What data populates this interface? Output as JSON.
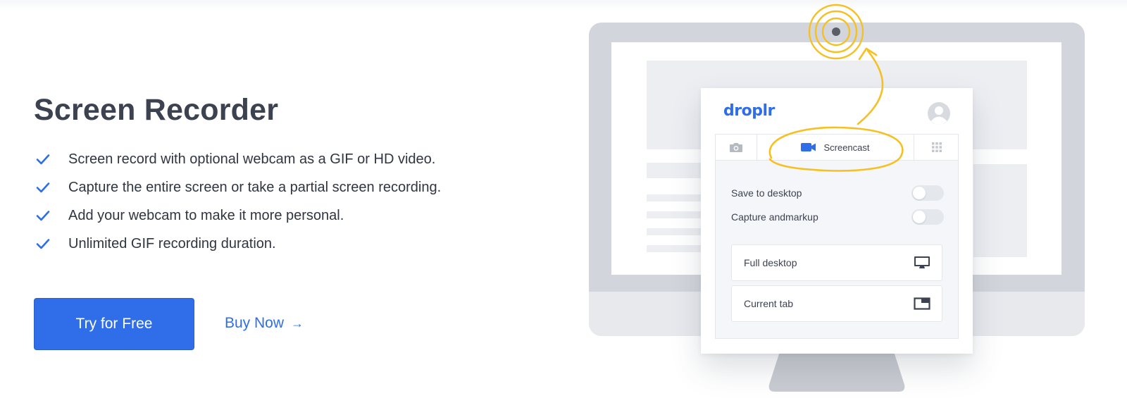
{
  "hero": {
    "title": "Screen Recorder",
    "features": [
      "Screen record with optional webcam as a GIF or HD video.",
      "Capture the entire screen or take a partial screen recording.",
      "Add your webcam to make it more personal.",
      "Unlimited GIF recording duration."
    ],
    "cta_primary": "Try for Free",
    "cta_secondary": "Buy Now",
    "secondary_arrow": "→"
  },
  "illustration": {
    "app_logo": "droplr",
    "tabs": {
      "screencast_label": "Screencast"
    },
    "options": [
      {
        "label": "Save to desktop",
        "enabled": false
      },
      {
        "label": "Capture andmarkup",
        "enabled": false
      }
    ],
    "capture_modes": [
      {
        "label": "Full desktop",
        "icon": "monitor-icon"
      },
      {
        "label": "Current tab",
        "icon": "window-tab-icon"
      }
    ]
  },
  "colors": {
    "accent": "#2f6ee8",
    "heading": "#3c4250",
    "highlight": "#f6c022",
    "monitor": "#d2d5db"
  }
}
